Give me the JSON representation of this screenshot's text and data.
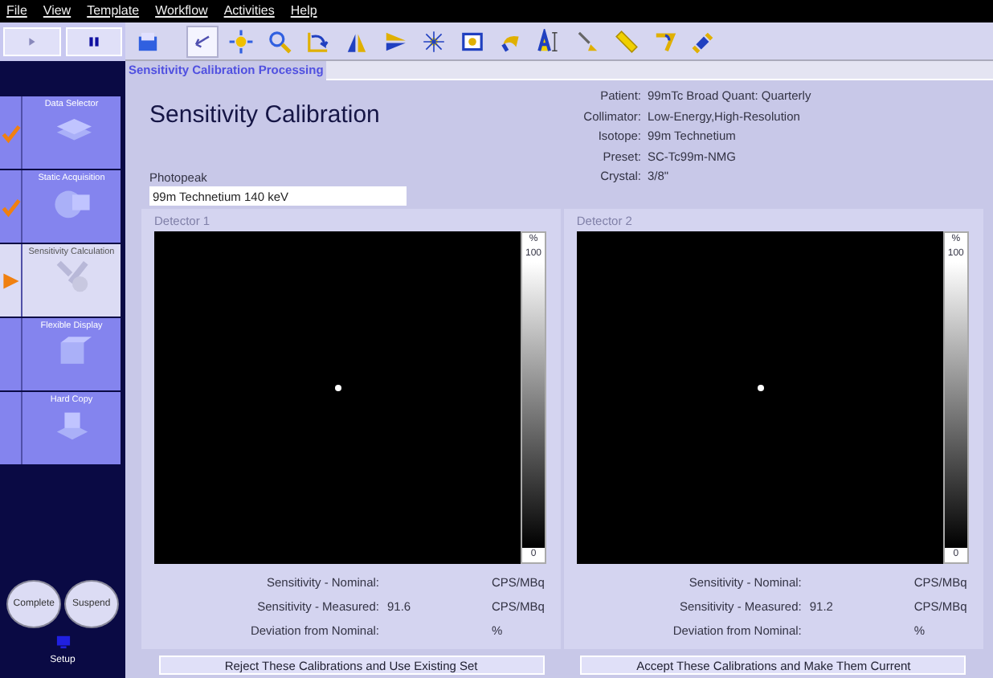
{
  "menu": [
    "File",
    "View",
    "Template",
    "Workflow",
    "Activities",
    "Help"
  ],
  "transport": [
    {
      "kind": "play"
    },
    {
      "kind": "pause"
    }
  ],
  "tools": [
    {
      "kind": "save",
      "selected": false
    },
    {
      "kind": "pointer",
      "selected": true
    },
    {
      "kind": "sun",
      "selected": false
    },
    {
      "kind": "zoom",
      "selected": false
    },
    {
      "kind": "rotate",
      "selected": false
    },
    {
      "kind": "mirror",
      "selected": false
    },
    {
      "kind": "flip",
      "selected": false
    },
    {
      "kind": "bright",
      "selected": false
    },
    {
      "kind": "window",
      "selected": false
    },
    {
      "kind": "undo",
      "selected": false
    },
    {
      "kind": "text",
      "selected": false
    },
    {
      "kind": "arrowlabel",
      "selected": false
    },
    {
      "kind": "ruler",
      "selected": false
    },
    {
      "kind": "angle",
      "selected": false
    },
    {
      "kind": "satellite",
      "selected": false
    }
  ],
  "tab": {
    "label": "Sensitivity Calibration Processing",
    "selected": true
  },
  "workflow": [
    {
      "label": "Data Selector",
      "done": true,
      "selected": false
    },
    {
      "label": "Static Acquisition",
      "done": true,
      "selected": false
    },
    {
      "label": "Sensitivity Calculation",
      "done": false,
      "selected": true
    },
    {
      "label": "Flexible Display",
      "done": false,
      "selected": false
    },
    {
      "label": "Hard Copy",
      "done": false,
      "selected": false
    }
  ],
  "actions": [
    "Complete",
    "Suspend"
  ],
  "setup": {
    "label": "Setup"
  },
  "title": "Sensitivity Calibration",
  "info": [
    {
      "label": "Patient:",
      "value": "99mTc Broad Quant: Quarterly"
    },
    {
      "label": "Collimator:",
      "value": "Low-Energy,High-Resolution"
    },
    {
      "label": "Isotope:",
      "value": "99m Technetium"
    },
    {
      "label": "Preset:",
      "value": "SC-Tc99m-NMG"
    },
    {
      "label": "Crystal:",
      "value": "3/8\""
    }
  ],
  "photopeak": {
    "label": "Photopeak",
    "value": "99m Technetium 140 keV"
  },
  "detectors": [
    {
      "title": "Detector 1",
      "scale_unit": "%",
      "scale_max": "100",
      "scale_min": "0",
      "rows": [
        {
          "label": "Sensitivity - Nominal:",
          "unit": "CPS/MBq"
        },
        {
          "label": "Sensitivity - Measured:",
          "value": "91.6",
          "unit": "CPS/MBq"
        },
        {
          "label": "Deviation from Nominal:",
          "unit": "%"
        }
      ],
      "button": "Reject These Calibrations and Use Existing Set"
    },
    {
      "title": "Detector 2",
      "scale_unit": "%",
      "scale_max": "100",
      "scale_min": "0",
      "rows": [
        {
          "label": "Sensitivity - Nominal:",
          "unit": "CPS/MBq"
        },
        {
          "label": "Sensitivity - Measured:",
          "value": "91.2",
          "unit": "CPS/MBq"
        },
        {
          "label": "Deviation from Nominal:",
          "unit": "%"
        }
      ],
      "button": "Accept These Calibrations and Make Them Current"
    }
  ]
}
